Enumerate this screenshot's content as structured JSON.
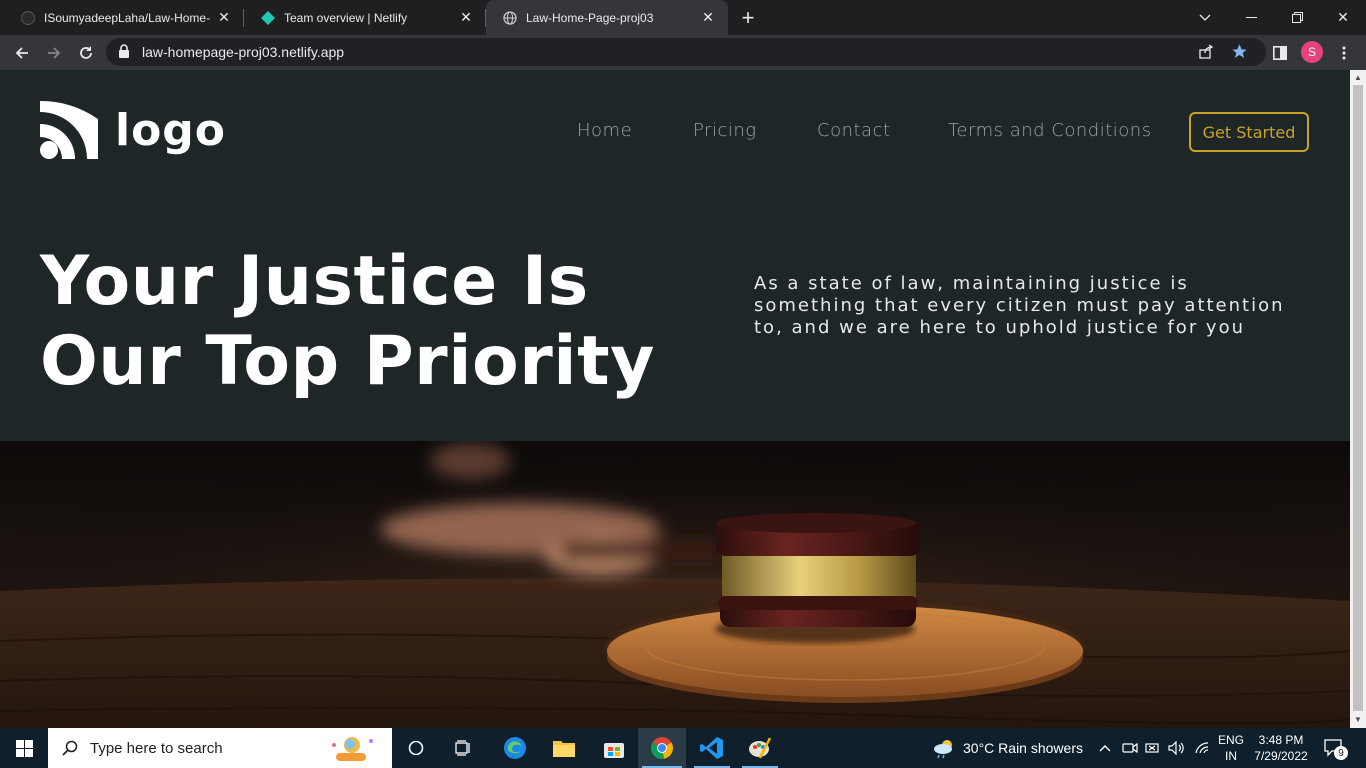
{
  "browser": {
    "tabs": [
      {
        "title": "ISoumyadeepLaha/Law-Home-Pa",
        "active": false
      },
      {
        "title": "Team overview | Netlify",
        "active": false
      },
      {
        "title": "Law-Home-Page-proj03",
        "active": true
      }
    ],
    "url": "law-homepage-proj03.netlify.app",
    "profile_initial": "S"
  },
  "page": {
    "logo_text": "logo",
    "nav": [
      "Home",
      "Pricing",
      "Contact",
      "Terms and Conditions"
    ],
    "cta_label": "Get Started",
    "hero_title_line1": "Your Justice Is",
    "hero_title_line2": "Our Top Priority",
    "hero_description": "As a state of law, maintaining justice is something that every citizen must pay attention to, and we are here to uphold justice for you",
    "colors": {
      "background": "#1f2628",
      "accent": "#c9a227",
      "nav_text": "#9aa3a5",
      "heading": "#ffffff"
    }
  },
  "taskbar": {
    "search_placeholder": "Type here to search",
    "weather": "30°C  Rain showers",
    "lang_line1": "ENG",
    "lang_line2": "IN",
    "time": "3:48 PM",
    "date": "7/29/2022",
    "notification_count": "9"
  }
}
